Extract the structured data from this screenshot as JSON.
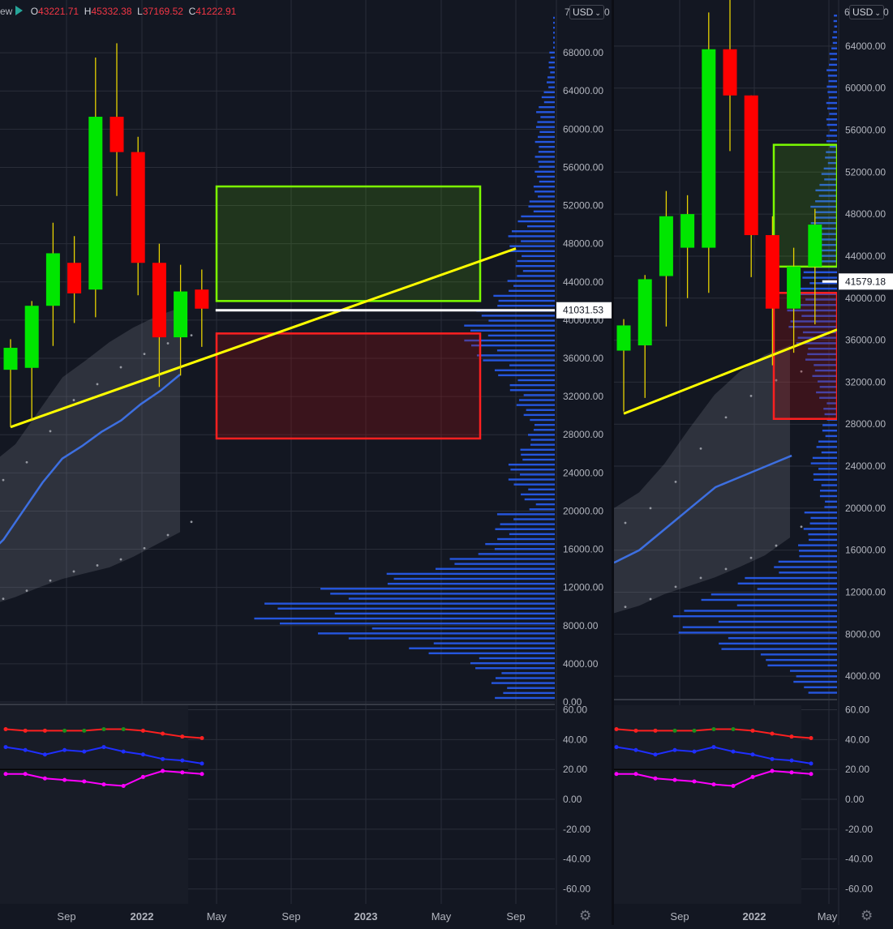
{
  "legend": {
    "mode": "ew",
    "open_label": "O",
    "open": "43221.71",
    "high_label": "H",
    "high": "45332.38",
    "low_label": "L",
    "low": "37169.52",
    "close_label": "C",
    "close": "41222.91"
  },
  "currency": {
    "label": "USD"
  },
  "top_axis_numbers": [
    "7",
    "0",
    "6",
    "0"
  ],
  "colors": {
    "background": "#131722",
    "grid": "#2a2e39",
    "bull": "#00e600",
    "bear": "#ff0000",
    "trendline": "#ffff00",
    "demand_zone": "#7cfc00",
    "supply_zone": "#ff2020",
    "volume_profile": "#2962ff",
    "ma": "#3d6fe0",
    "price_line": "#ffffff"
  },
  "icons": [
    "flag-icon",
    "chevron-down-icon",
    "gear-icon"
  ],
  "chart_data": [
    {
      "type": "candlestick",
      "title": "",
      "x_tick_labels": [
        "Sep",
        "2022",
        "May",
        "Sep",
        "2023",
        "May",
        "Sep"
      ],
      "y_tick_labels": [
        "68000.00",
        "64000.00",
        "60000.00",
        "56000.00",
        "52000.00",
        "48000.00",
        "44000.00",
        "40000.00",
        "36000.00",
        "32000.00",
        "28000.00",
        "24000.00",
        "20000.00",
        "16000.00",
        "12000.00",
        "8000.00",
        "4000.00",
        "0.00"
      ],
      "ylim": [
        0,
        72000
      ],
      "price_label": "41031.53",
      "price_value": 41031.53,
      "candles": [
        {
          "o": 34800,
          "h": 38000,
          "l": 28800,
          "c": 37100
        },
        {
          "o": 35000,
          "h": 42000,
          "l": 29500,
          "c": 41500
        },
        {
          "o": 41500,
          "h": 50200,
          "l": 37300,
          "c": 47000
        },
        {
          "o": 46000,
          "h": 48800,
          "l": 39700,
          "c": 42800
        },
        {
          "o": 43200,
          "h": 67500,
          "l": 40300,
          "c": 61300
        },
        {
          "o": 61300,
          "h": 69000,
          "l": 53000,
          "c": 57600
        },
        {
          "o": 57600,
          "h": 59200,
          "l": 42600,
          "c": 46000
        },
        {
          "o": 46000,
          "h": 48000,
          "l": 33000,
          "c": 38200
        },
        {
          "o": 38200,
          "h": 45800,
          "l": 34200,
          "c": 43000
        },
        {
          "o": 43200,
          "h": 45300,
          "l": 37200,
          "c": 41200
        }
      ],
      "demand_zone": {
        "top": 54000,
        "bottom": 42000
      },
      "supply_zone": {
        "top": 38600,
        "bottom": 27600
      },
      "trendline": {
        "from": 28800,
        "to": 47500
      },
      "moving_average": [
        15000,
        17000,
        20000,
        23000,
        25500,
        26800,
        28300,
        29500,
        31200,
        32600,
        34300
      ],
      "band_upper": [
        25000,
        27000,
        30500,
        34000,
        35800,
        37700,
        39200,
        40400,
        41300
      ],
      "band_lower": [
        10200,
        11000,
        12000,
        12900,
        13500,
        14100,
        15200,
        16500,
        17800
      ]
    },
    {
      "type": "line",
      "title": "",
      "y_tick_labels": [
        "60.00",
        "40.00",
        "20.00",
        "0.00",
        "-20.00",
        "-40.00",
        "-60.00"
      ],
      "ylim": [
        -70,
        63
      ],
      "series": [
        {
          "color": "#ff2020",
          "values": [
            47,
            46,
            46,
            46,
            46,
            47,
            47,
            46,
            44,
            42,
            41
          ]
        },
        {
          "color": "#1f2fff",
          "values": [
            35,
            33,
            30,
            33,
            32,
            35,
            32,
            30,
            27,
            26,
            24
          ]
        },
        {
          "color": "#ff00ff",
          "values": [
            17,
            17,
            14,
            13,
            12,
            10,
            9,
            15,
            19,
            18,
            17
          ]
        }
      ]
    },
    {
      "type": "candlestick",
      "title": "",
      "x_tick_labels": [
        "Sep",
        "2022",
        "May"
      ],
      "y_tick_labels": [
        "64000.00",
        "60000.00",
        "56000.00",
        "52000.00",
        "48000.00",
        "44000.00",
        "40000.00",
        "36000.00",
        "32000.00",
        "28000.00",
        "24000.00",
        "20000.00",
        "16000.00",
        "12000.00",
        "8000.00",
        "4000.00"
      ],
      "ylim": [
        2000,
        67000
      ],
      "price_label": "41579.18",
      "price_value": 41579.18,
      "candles": [
        {
          "o": 35000,
          "h": 38000,
          "l": 29200,
          "c": 37400
        },
        {
          "o": 35500,
          "h": 42200,
          "l": 30500,
          "c": 41800
        },
        {
          "o": 42100,
          "h": 50200,
          "l": 37300,
          "c": 47800
        },
        {
          "o": 44800,
          "h": 49800,
          "l": 40000,
          "c": 48000
        },
        {
          "o": 44800,
          "h": 67200,
          "l": 40500,
          "c": 63700
        },
        {
          "o": 63700,
          "h": 69000,
          "l": 54000,
          "c": 59300
        },
        {
          "o": 59300,
          "h": 58000,
          "l": 42000,
          "c": 46000
        },
        {
          "o": 46000,
          "h": 47800,
          "l": 33600,
          "c": 39000
        },
        {
          "o": 39000,
          "h": 44800,
          "l": 34800,
          "c": 43000
        },
        {
          "o": 43000,
          "h": 48500,
          "l": 37500,
          "c": 47000
        }
      ],
      "demand_zone": {
        "top": 54600,
        "bottom": 43000
      },
      "supply_zone": {
        "top": 40500,
        "bottom": 28500
      },
      "trendline": {
        "from": 29000,
        "to": 37000
      },
      "moving_average": [
        14800,
        16000,
        18000,
        20000,
        22000,
        23000,
        24000,
        25000
      ],
      "band_upper": [
        20000,
        21500,
        24200,
        27600,
        30800,
        33000,
        34600,
        35500
      ],
      "band_lower": [
        10000,
        10700,
        11800,
        12600,
        13400,
        14400,
        15500,
        17200
      ]
    },
    {
      "type": "line",
      "title": "",
      "y_tick_labels": [
        "60.00",
        "40.00",
        "20.00",
        "0.00",
        "-20.00",
        "-40.00",
        "-60.00"
      ],
      "ylim": [
        -70,
        63
      ],
      "series": [
        {
          "color": "#ff2020",
          "values": [
            47,
            46,
            46,
            46,
            46,
            47,
            47,
            46,
            44,
            42,
            41
          ]
        },
        {
          "color": "#1f2fff",
          "values": [
            35,
            33,
            30,
            33,
            32,
            35,
            32,
            30,
            27,
            26,
            24
          ]
        },
        {
          "color": "#ff00ff",
          "values": [
            17,
            17,
            14,
            13,
            12,
            10,
            9,
            15,
            19,
            18,
            17
          ]
        }
      ]
    }
  ]
}
